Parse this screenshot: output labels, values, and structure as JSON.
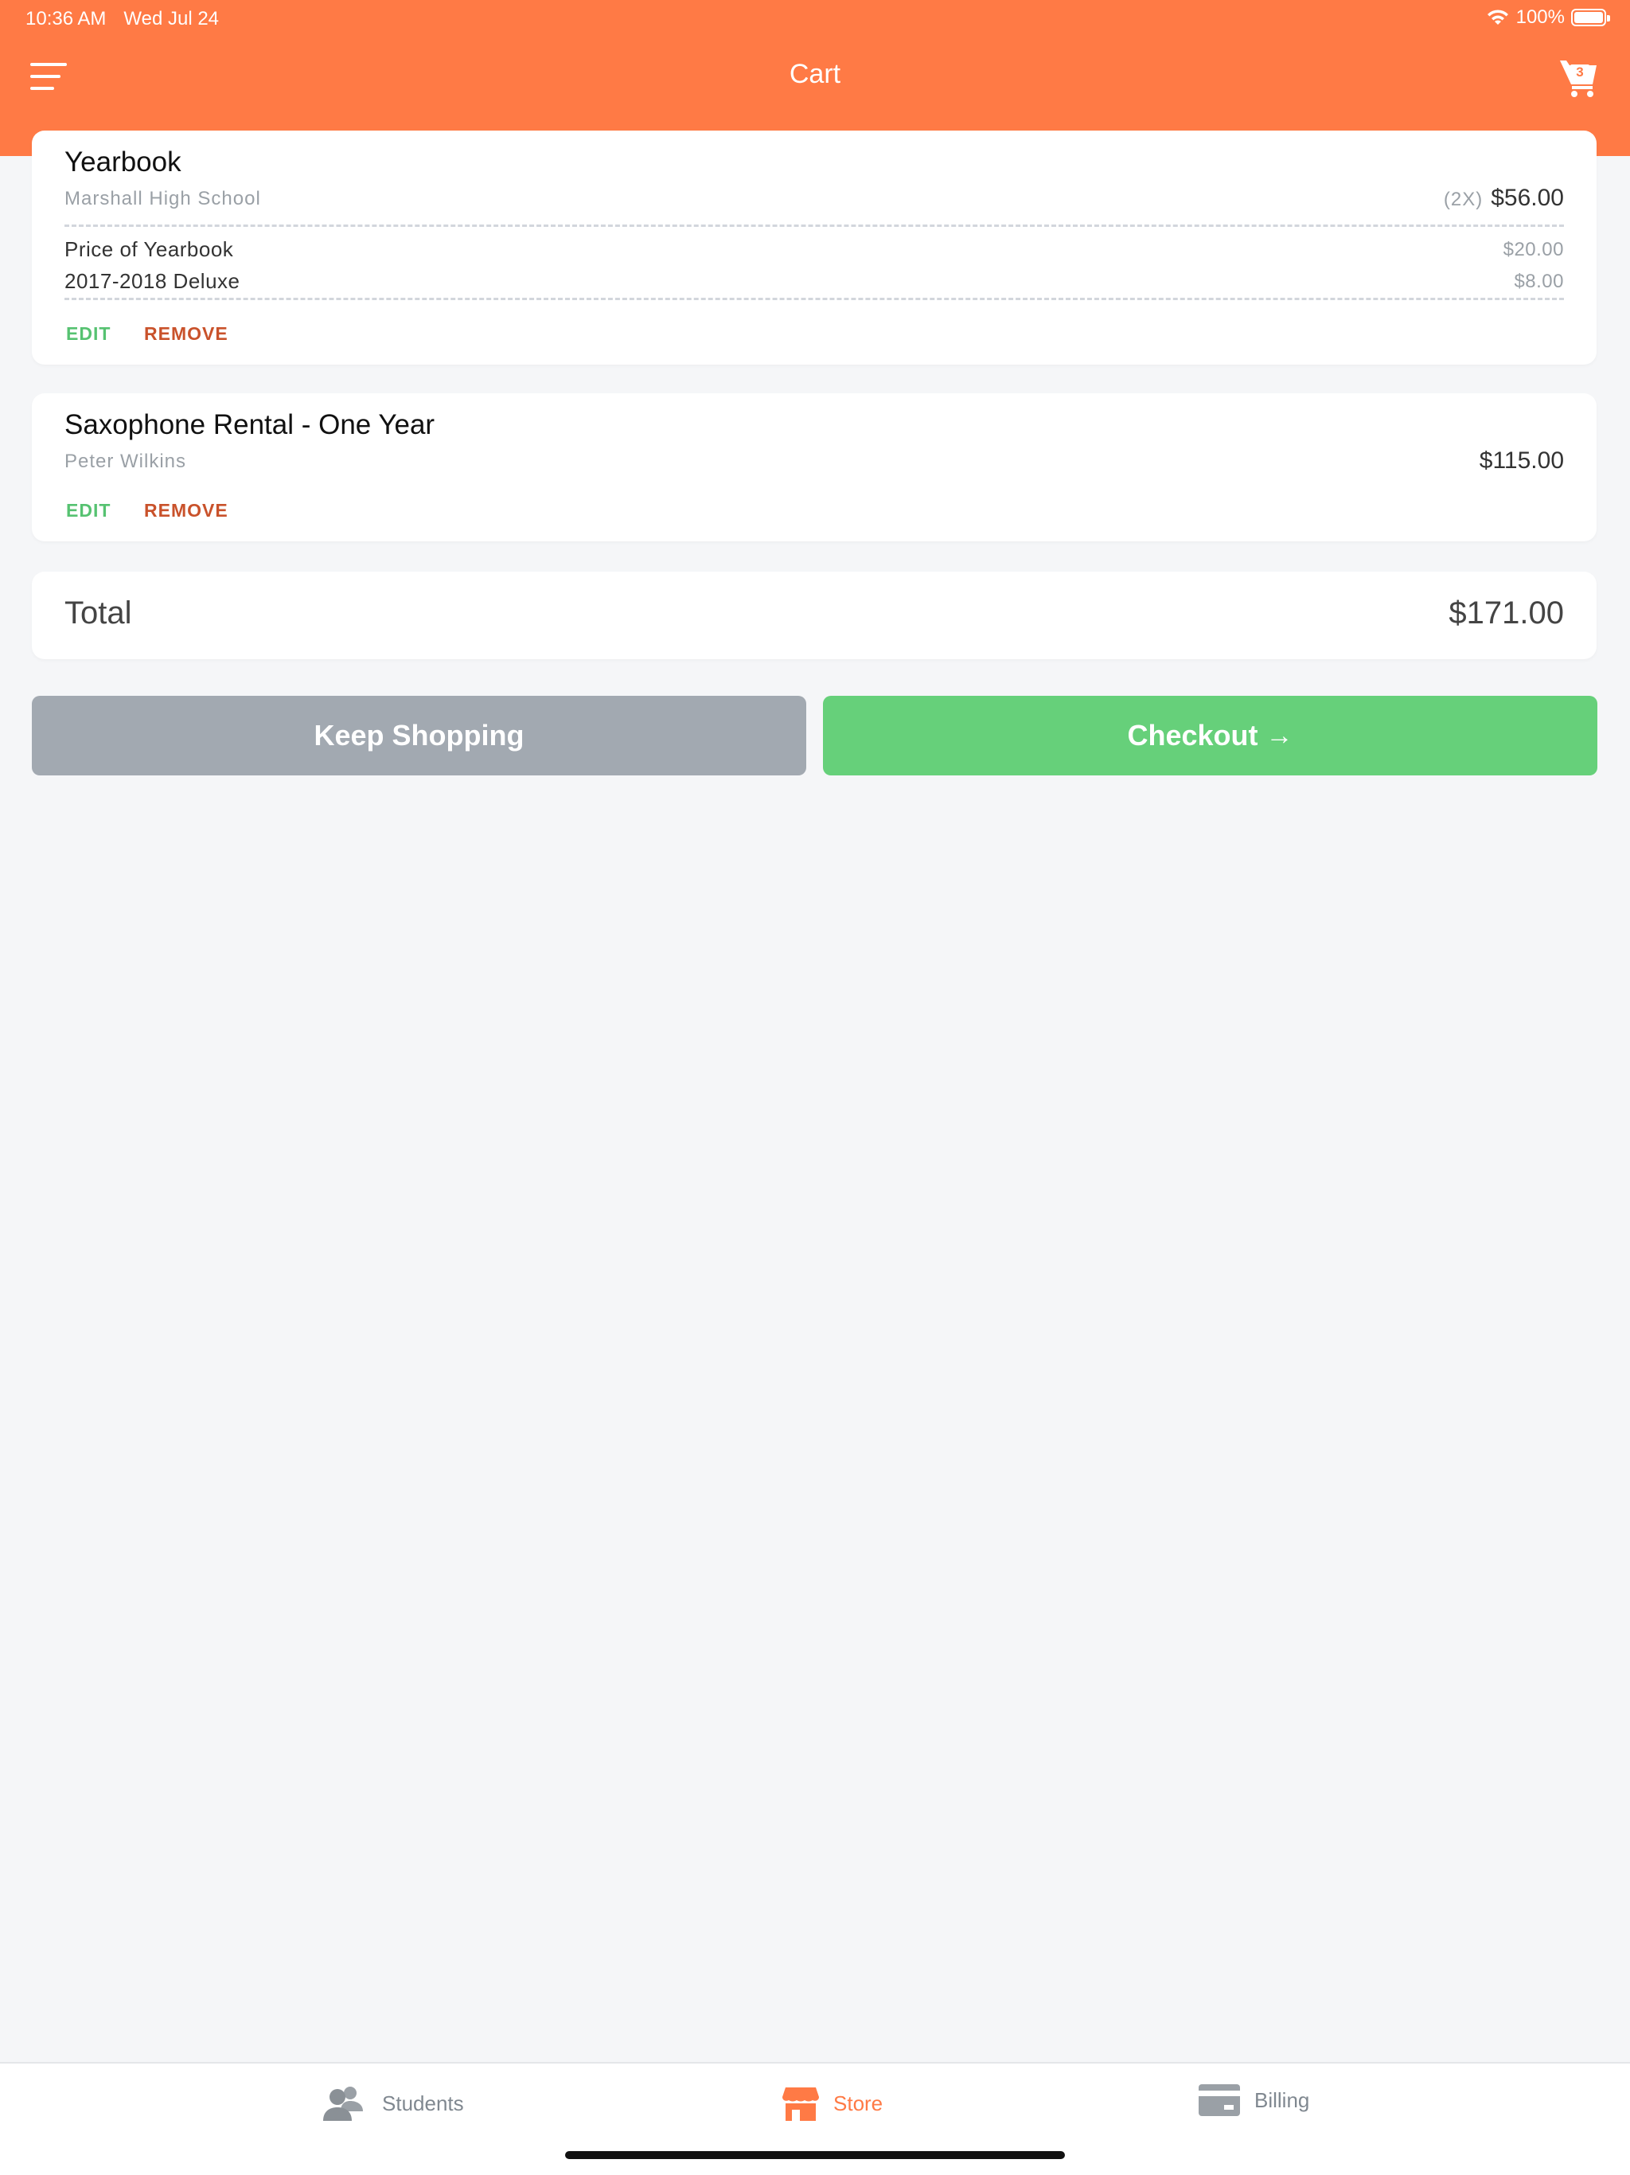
{
  "status_bar": {
    "time": "10:36 AM",
    "date": "Wed Jul 24",
    "battery": "100%"
  },
  "header": {
    "title": "Cart",
    "cart_count": "3"
  },
  "cart": {
    "items": [
      {
        "title": "Yearbook",
        "subtitle": "Marshall High School",
        "qty": "(2X)",
        "price": "$56.00",
        "lines": [
          {
            "label": "Price of Yearbook",
            "amount": "$20.00"
          },
          {
            "label": "2017-2018 Deluxe",
            "amount": "$8.00"
          }
        ],
        "edit_label": "EDIT",
        "remove_label": "REMOVE"
      },
      {
        "title": "Saxophone Rental - One Year",
        "subtitle": "Peter Wilkins",
        "price": "$115.00",
        "edit_label": "EDIT",
        "remove_label": "REMOVE"
      }
    ],
    "total_label": "Total",
    "total_amount": "$171.00"
  },
  "actions": {
    "keep_shopping": "Keep Shopping",
    "checkout": "Checkout",
    "checkout_arrow": "→"
  },
  "tabs": [
    {
      "label": "Students",
      "icon": "users-icon"
    },
    {
      "label": "Store",
      "icon": "store-icon",
      "active": true
    },
    {
      "label": "Billing",
      "icon": "credit-card-icon"
    }
  ],
  "colors": {
    "brand": "#ff7a45",
    "success": "#66d07a",
    "danger": "#c9522b",
    "muted": "#a2a9b1"
  }
}
